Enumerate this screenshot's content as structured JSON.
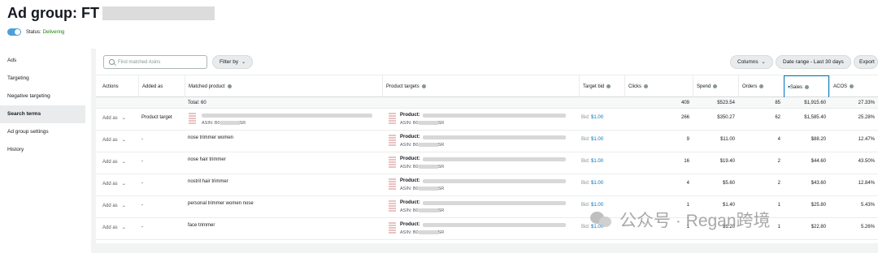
{
  "header": {
    "title": "Ad group: FT",
    "status_label": "Status:",
    "status_value": "Delivering"
  },
  "sidebar": {
    "items": [
      {
        "label": "Ads"
      },
      {
        "label": "Targeting"
      },
      {
        "label": "Negative targeting"
      },
      {
        "label": "Search terms"
      },
      {
        "label": "Ad group settings"
      },
      {
        "label": "History"
      }
    ],
    "active": "Search terms"
  },
  "toolbar": {
    "search_placeholder": "Find matched Asins",
    "filter_label": "Filter by",
    "columns_label": "Columns",
    "date_range_label": "Date range - Last 30 days",
    "export_label": "Export"
  },
  "table": {
    "headers": {
      "actions": "Actions",
      "added_as": "Added as",
      "matched_product": "Matched product",
      "product_targets": "Product targets",
      "target_bid": "Target bid",
      "clicks": "Clicks",
      "spend": "Spend",
      "orders": "Orders",
      "sales": "Sales",
      "acos": "ACOS"
    },
    "sorted_column": "Sales",
    "totals": {
      "label": "Total: 60",
      "clicks": "409",
      "spend": "$523.54",
      "orders": "85",
      "sales": "$1,915.60",
      "acos": "27.33%"
    },
    "add_as_label": "Add as",
    "product_label": "Product:",
    "asin_prefix": "ASIN: B0",
    "asin_suffix": "SR",
    "bid_prefix": "Bid:",
    "rows": [
      {
        "added_as": "Product target",
        "matched": "",
        "bid": "$1.00",
        "clicks": "266",
        "spend": "$350.27",
        "orders": "62",
        "sales": "$1,585.40",
        "acos": "25.28%"
      },
      {
        "added_as": "-",
        "matched": "nose trimmer women",
        "bid": "$1.00",
        "clicks": "9",
        "spend": "$11.00",
        "orders": "4",
        "sales": "$88.20",
        "acos": "12.47%"
      },
      {
        "added_as": "-",
        "matched": "nose hair trimmer",
        "bid": "$1.00",
        "clicks": "16",
        "spend": "$19.40",
        "orders": "2",
        "sales": "$44.60",
        "acos": "43.50%"
      },
      {
        "added_as": "-",
        "matched": "nostril hair trimmer",
        "bid": "$1.00",
        "clicks": "4",
        "spend": "$5.60",
        "orders": "2",
        "sales": "$43.60",
        "acos": "12.84%"
      },
      {
        "added_as": "-",
        "matched": "personal trimmer women nose",
        "bid": "$1.00",
        "clicks": "1",
        "spend": "$1.40",
        "orders": "1",
        "sales": "$25.80",
        "acos": "5.43%"
      },
      {
        "added_as": "-",
        "matched": "face trimmer",
        "bid": "$1.00",
        "clicks": "1",
        "spend": "$1.20",
        "orders": "1",
        "sales": "$22.80",
        "acos": "5.26%"
      }
    ]
  },
  "watermark": {
    "text": "公众号 · Regan跨境"
  }
}
